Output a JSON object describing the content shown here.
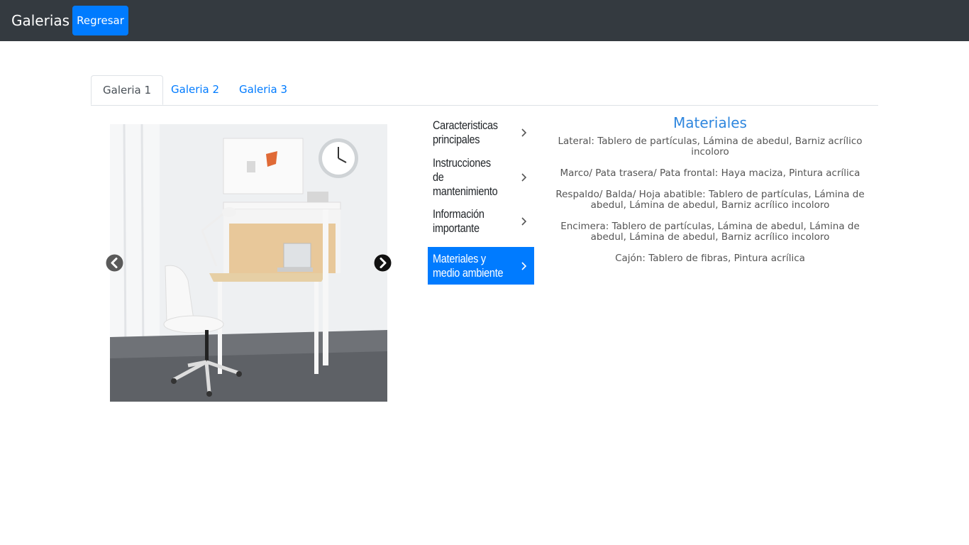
{
  "navbar": {
    "brand": "Galerias",
    "back_label": "Regresar"
  },
  "tabs": [
    {
      "label": "Galeria 1",
      "active": true
    },
    {
      "label": "Galeria 2",
      "active": false
    },
    {
      "label": "Galeria 3",
      "active": false
    }
  ],
  "carousel": {
    "prev_icon": "chevron-left-icon",
    "next_icon": "chevron-right-icon"
  },
  "menu": [
    {
      "label": "Caracteristicas principales",
      "active": false
    },
    {
      "label": "Instrucciones de mantenimiento",
      "active": false
    },
    {
      "label": "Información importante",
      "active": false
    },
    {
      "label": "Materiales y medio ambiente",
      "active": true
    }
  ],
  "content": {
    "title": "Materiales",
    "paragraphs": [
      "Lateral: Tablero de partículas, Lámina de abedul, Barniz acrílico incoloro",
      "Marco/ Pata trasera/ Pata frontal: Haya maciza, Pintura acrílica",
      "Respaldo/ Balda/ Hoja abatible: Tablero de partículas, Lámina de abedul, Lámina de abedul, Barniz acrílico incoloro",
      "Encimera: Tablero de partículas, Lámina de abedul, Lámina de abedul, Lámina de abedul, Barniz acrílico incoloro",
      "Cajón: Tablero de fibras, Pintura acrílica"
    ]
  },
  "colors": {
    "navbar": "#343a40",
    "primary": "#007bff",
    "title": "#2e86de"
  }
}
